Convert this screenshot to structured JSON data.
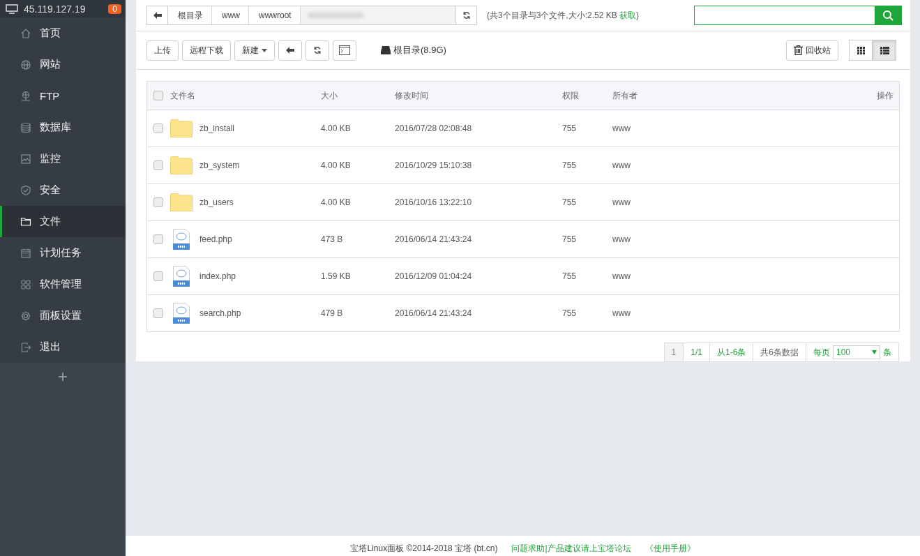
{
  "sidebar": {
    "host": "45.119.127.19",
    "badge": "0",
    "items": [
      {
        "label": "首页",
        "selected": false
      },
      {
        "label": "网站",
        "selected": false
      },
      {
        "label": "FTP",
        "selected": false
      },
      {
        "label": "数据库",
        "selected": false
      },
      {
        "label": "监控",
        "selected": false
      },
      {
        "label": "安全",
        "selected": false
      },
      {
        "label": "文件",
        "selected": true
      },
      {
        "label": "计划任务",
        "selected": false
      },
      {
        "label": "软件管理",
        "selected": false
      },
      {
        "label": "面板设置",
        "selected": false
      },
      {
        "label": "退出",
        "selected": false
      }
    ],
    "add": "+"
  },
  "breadcrumb": {
    "segments": [
      "根目录",
      "www",
      "wwwroot"
    ]
  },
  "summary": {
    "text": "(共3个目录与3个文件,大小:2.52 KB",
    "link": "获取",
    "close": ")"
  },
  "toolbar": {
    "buttons": [
      {
        "label": "上传",
        "kind": "text"
      },
      {
        "label": "远程下载",
        "kind": "text"
      },
      {
        "label": "新建",
        "kind": "dropdown"
      }
    ],
    "disk": "根目录(8.9G)",
    "recycle": "回收站",
    "views": [
      {
        "kind": "grid",
        "selected": false
      },
      {
        "kind": "list",
        "selected": true
      }
    ]
  },
  "table": {
    "columns": [
      "文件名",
      "大小",
      "修改时间",
      "权限",
      "所有者",
      "操作"
    ],
    "all_checked": false,
    "rows": [
      {
        "kind": "folder",
        "name": "zb_install",
        "size": "4.00 KB",
        "modified": "2016/07/28 02:08:48",
        "permission": "755",
        "owner": "www",
        "checked": false
      },
      {
        "kind": "folder",
        "name": "zb_system",
        "size": "4.00 KB",
        "modified": "2016/10/29 15:10:38",
        "permission": "755",
        "owner": "www",
        "checked": false
      },
      {
        "kind": "folder",
        "name": "zb_users",
        "size": "4.00 KB",
        "modified": "2016/10/16 13:22:10",
        "permission": "755",
        "owner": "www",
        "checked": false
      },
      {
        "kind": "php",
        "name": "feed.php",
        "size": "473 B",
        "modified": "2016/06/14 21:43:24",
        "permission": "755",
        "owner": "www",
        "checked": false
      },
      {
        "kind": "php",
        "name": "index.php",
        "size": "1.59 KB",
        "modified": "2016/12/09 01:04:24",
        "permission": "755",
        "owner": "www",
        "checked": false
      },
      {
        "kind": "php",
        "name": "search.php",
        "size": "479 B",
        "modified": "2016/06/14 21:43:24",
        "permission": "755",
        "owner": "www",
        "checked": false
      }
    ]
  },
  "pagination": {
    "current": "1",
    "pages": "1/1",
    "range": "从1-6条",
    "total": "共6条数据",
    "per_page_label": "每页",
    "per_page": "100",
    "unit": "条"
  },
  "footer": {
    "copyright": "宝塔Linux面板 ©2014-2018 宝塔 (bt.cn)",
    "links": [
      "问题求助|产品建议请上宝塔论坛",
      "《使用手册》"
    ]
  }
}
